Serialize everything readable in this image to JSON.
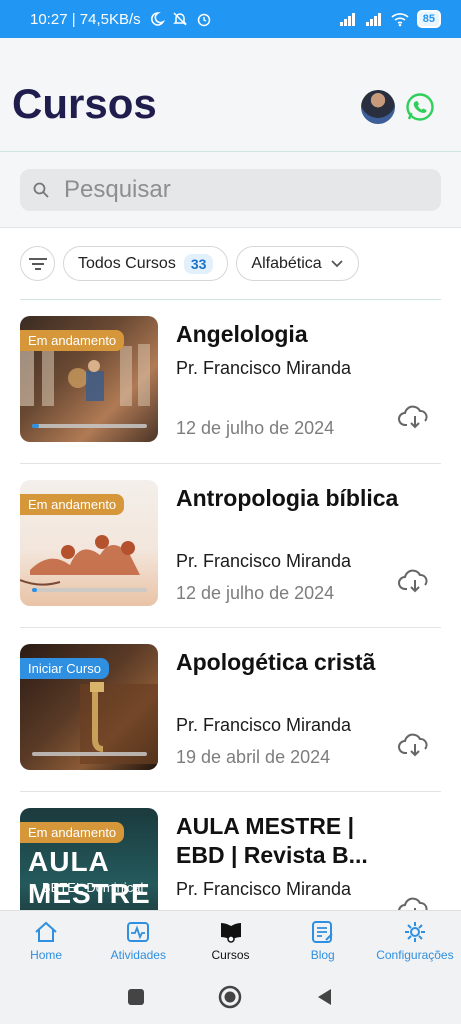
{
  "status_bar": {
    "time_info": "10:27 | 74,5KB/s",
    "battery": "85"
  },
  "header": {
    "title": "Cursos"
  },
  "search": {
    "placeholder": "Pesquisar"
  },
  "filters": {
    "all_courses_label": "Todos Cursos",
    "all_courses_count": "33",
    "sort_label": "Alfabética"
  },
  "courses": [
    {
      "title": "Angelologia",
      "author": "Pr. Francisco Miranda",
      "date": "12 de julho de 2024",
      "badge": "Em andamento",
      "progress": 0.06
    },
    {
      "title": "Antropologia bíblica",
      "author": "Pr. Francisco Miranda",
      "date": "12 de julho de 2024",
      "badge": "Em andamento",
      "progress": 0.04
    },
    {
      "title": "Apologética cristã",
      "author": "Pr. Francisco Miranda",
      "date": "19 de abril de 2024",
      "badge": "Iniciar Curso",
      "progress": 0
    },
    {
      "title": "AULA MESTRE | EBD | Revista B...",
      "author": "Pr. Francisco Miranda",
      "date": "",
      "badge": "Em andamento",
      "thumb_text": "AULA MESTRE",
      "thumb_sub": "BETEL Dominical"
    }
  ],
  "bottom_nav": [
    {
      "label": "Home",
      "icon": "home-icon"
    },
    {
      "label": "Atividades",
      "icon": "activity-icon"
    },
    {
      "label": "Cursos",
      "icon": "courses-icon"
    },
    {
      "label": "Blog",
      "icon": "blog-icon"
    },
    {
      "label": "Configurações",
      "icon": "gear-icon"
    }
  ],
  "colors": {
    "primary": "#2f8fe0",
    "title": "#1f1d4d",
    "badge_progress": "#d6973a",
    "badge_start": "#2f8fe0"
  }
}
